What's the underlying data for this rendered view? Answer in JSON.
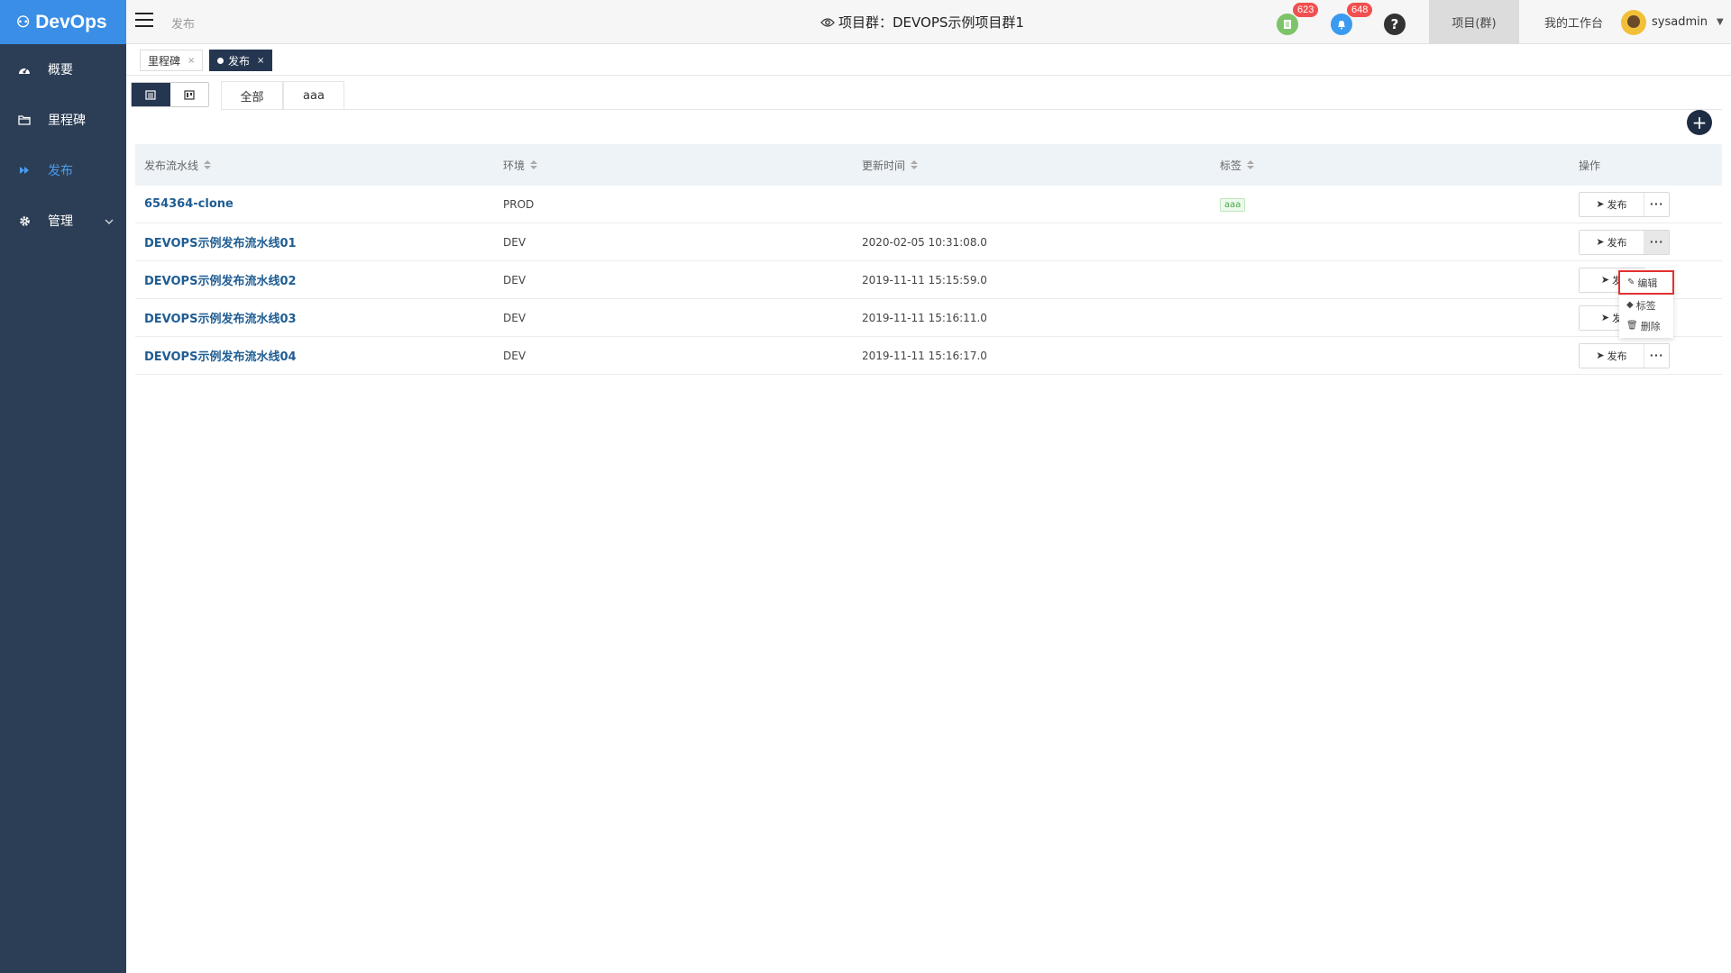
{
  "app": {
    "brand": "DevOps"
  },
  "sidebar": {
    "items": [
      {
        "label": "概要",
        "icon": "dashboard-icon"
      },
      {
        "label": "里程碑",
        "icon": "folder-icon"
      },
      {
        "label": "发布",
        "icon": "forward-icon",
        "active": true
      },
      {
        "label": "管理",
        "icon": "gear-icon",
        "has_submenu": true
      }
    ]
  },
  "header": {
    "breadcrumb": "发布",
    "project_title": "项目群：DEVOPS示例项目群1",
    "todo_badge": "623",
    "notify_badge": "648",
    "nav_project": "项目(群)",
    "nav_workspace": "我的工作台",
    "username": "sysadmin"
  },
  "page_tabs": [
    {
      "label": "里程碑",
      "active": false
    },
    {
      "label": "发布",
      "active": true
    }
  ],
  "filter_tabs": [
    {
      "label": "全部",
      "active": true
    },
    {
      "label": "aaa",
      "active": false
    }
  ],
  "table": {
    "headers": [
      "发布流水线",
      "环境",
      "更新时间",
      "标签",
      "操作"
    ],
    "rows": [
      {
        "name": "654364-clone",
        "env": "PROD",
        "updated": "",
        "tag": "aaa"
      },
      {
        "name": "DEVOPS示例发布流水线01",
        "env": "DEV",
        "updated": "2020-02-05 10:31:08.0",
        "tag": ""
      },
      {
        "name": "DEVOPS示例发布流水线02",
        "env": "DEV",
        "updated": "2019-11-11 15:15:59.0",
        "tag": ""
      },
      {
        "name": "DEVOPS示例发布流水线03",
        "env": "DEV",
        "updated": "2019-11-11 15:16:11.0",
        "tag": ""
      },
      {
        "name": "DEVOPS示例发布流水线04",
        "env": "DEV",
        "updated": "2019-11-11 15:16:17.0",
        "tag": ""
      }
    ],
    "publish_label": "发布",
    "publish_partial": "发",
    "more_label": "···"
  },
  "dropdown": {
    "items": [
      {
        "label": "编辑",
        "icon": "edit-icon",
        "highlighted": true
      },
      {
        "label": "标签",
        "icon": "tag-icon"
      },
      {
        "label": "删除",
        "icon": "trash-icon"
      }
    ]
  },
  "colors": {
    "sidebar_bg": "#2c3e55",
    "brand_bg": "#3a8ee6",
    "active_tab": "#253650",
    "link": "#1f5d93",
    "highlight_border": "#e33030"
  }
}
